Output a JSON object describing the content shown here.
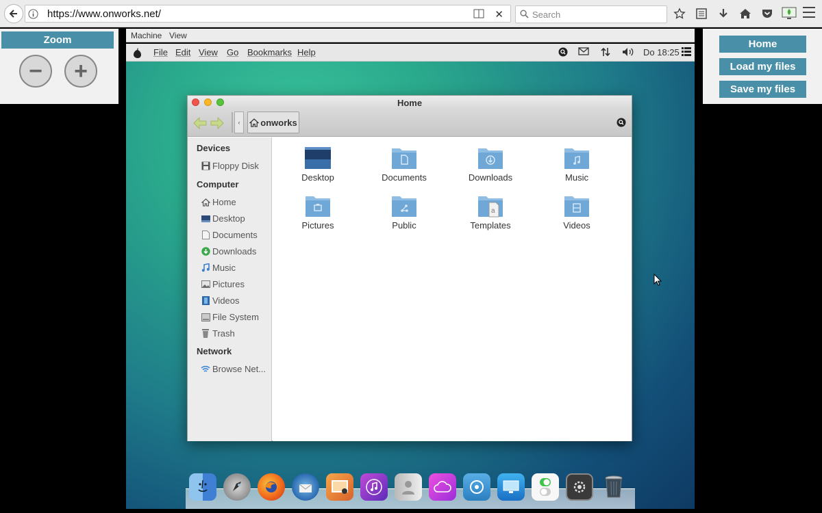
{
  "browser": {
    "url": "https://www.onworks.net/",
    "search_placeholder": "Search"
  },
  "zoom_panel": {
    "title": "Zoom",
    "minus": "−",
    "plus": "+"
  },
  "right_panel": {
    "home": "Home",
    "load": "Load my files",
    "save": "Save my files"
  },
  "vm_menu": {
    "machine": "Machine",
    "view": "View"
  },
  "mac_menubar": {
    "items": [
      "File",
      "Edit",
      "View",
      "Go",
      "Bookmarks",
      "Help"
    ],
    "clock": "Do 18:25"
  },
  "file_manager": {
    "title": "Home",
    "path_button": "onworks",
    "path_left": "‹",
    "sidebar": {
      "devices_heading": "Devices",
      "devices": [
        "Floppy Disk"
      ],
      "computer_heading": "Computer",
      "computer": [
        "Home",
        "Desktop",
        "Documents",
        "Downloads",
        "Music",
        "Pictures",
        "Videos",
        "File System",
        "Trash"
      ],
      "network_heading": "Network",
      "network": [
        "Browse Net..."
      ]
    },
    "folders": [
      "Desktop",
      "Documents",
      "Downloads",
      "Music",
      "Pictures",
      "Public",
      "Templates",
      "Videos"
    ]
  },
  "dock_apps": [
    "finder-icon",
    "launchpad-icon",
    "firefox-icon",
    "thunderbird-icon",
    "photos-icon",
    "itunes-icon",
    "contacts-icon",
    "icloud-icon",
    "cydia-icon",
    "display-icon",
    "toggles-icon",
    "system-icon",
    "trash-icon"
  ],
  "colors": {
    "panel_accent": "#4a8fa8",
    "folder_blue": "#6fa8d6"
  }
}
